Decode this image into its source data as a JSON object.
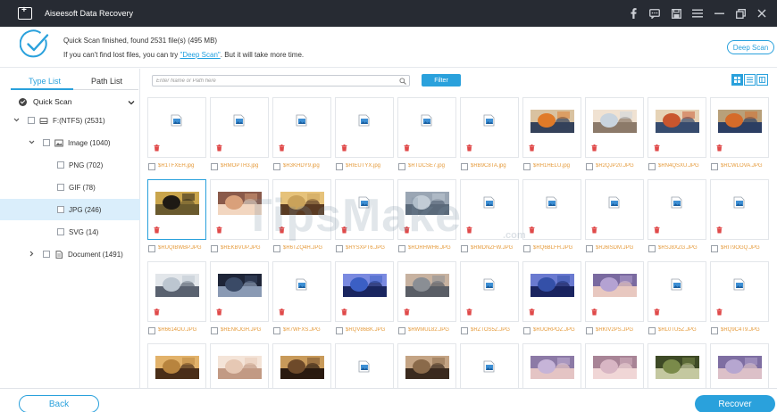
{
  "app": {
    "title": "Aiseesoft Data Recovery"
  },
  "titlebar_icons": [
    "facebook-icon",
    "chat-icon",
    "save-icon",
    "menu-icon",
    "minimize-icon",
    "restore-icon",
    "close-icon"
  ],
  "header": {
    "status": "Quick Scan finished, found 2531 file(s) (495 MB)",
    "hint_prefix": "If you can't find lost files, you can try ",
    "hint_link": "\"Deep Scan\"",
    "hint_suffix": ". But it will take more time.",
    "deep_scan_label": "Deep Scan"
  },
  "sidebar": {
    "tabs": [
      "Type List",
      "Path List"
    ],
    "active_tab": 0,
    "scan_mode": "Quick Scan",
    "tree": [
      {
        "label": "F:(NTFS) (2531)",
        "level": 0,
        "expanded": true,
        "icon": "drive-icon"
      },
      {
        "label": "Image (1040)",
        "level": 1,
        "expanded": true,
        "icon": "image-folder-icon"
      },
      {
        "label": "PNG (702)",
        "level": 2
      },
      {
        "label": "GIF (78)",
        "level": 2
      },
      {
        "label": "JPG (246)",
        "level": 2,
        "selected": true
      },
      {
        "label": "SVG (14)",
        "level": 2
      },
      {
        "label": "Document (1491)",
        "level": 1,
        "expanded": false,
        "icon": "document-icon"
      }
    ]
  },
  "toolbar": {
    "search_placeholder": "Enter Name or Path here",
    "filter_label": "Filter",
    "view_modes": [
      "grid-view-icon",
      "list-view-icon",
      "detail-view-icon"
    ]
  },
  "files": [
    {
      "name": "$R1TFXEH.jpg",
      "photo": false
    },
    {
      "name": "$RMOPTH3.jpg",
      "photo": false
    },
    {
      "name": "$R3KHDY9.jpg",
      "photo": false
    },
    {
      "name": "$RIEUTYX.jpg",
      "photo": false
    },
    {
      "name": "$RTDCSE7.jpg",
      "photo": false
    },
    {
      "name": "$RB9C8TA.jpg",
      "photo": false
    },
    {
      "name": "$RH1HELU.jpg",
      "photo": true,
      "colors": [
        "#e07a28",
        "#35425a",
        "#d9c2a0"
      ]
    },
    {
      "name": "$R2QJP20.JPG",
      "photo": true,
      "colors": [
        "#c9d4de",
        "#8c7a6a",
        "#f0e2d2"
      ]
    },
    {
      "name": "$RN4QSXU.JPG",
      "photo": true,
      "colors": [
        "#c9562e",
        "#374c6e",
        "#e6d3b6"
      ]
    },
    {
      "name": "$RCWLOVA.JPG",
      "photo": true,
      "colors": [
        "#d56b2a",
        "#2c3e63",
        "#b8a07a"
      ]
    },
    {
      "name": "$RUQIBWBP.JPG",
      "photo": true,
      "selected": true,
      "colors": [
        "#1e1a14",
        "#6a5a2e",
        "#c9a54c"
      ]
    },
    {
      "name": "$REKBVUP.JPG",
      "photo": true,
      "colors": [
        "#d9a07a",
        "#f2d6c0",
        "#8a5a4a"
      ]
    },
    {
      "name": "$R6TZQ4H.JPG",
      "photo": true,
      "colors": [
        "#caa25a",
        "#5a3b22",
        "#e6c27a"
      ]
    },
    {
      "name": "$RYSXPT6.JPG",
      "photo": false
    },
    {
      "name": "$RORHWH6.JPG",
      "photo": true,
      "colors": [
        "#c2ccd6",
        "#5b6a7a",
        "#9aa6b4"
      ]
    },
    {
      "name": "$RMDNZFW.JPG",
      "photo": false
    },
    {
      "name": "$RQ6BLFH.JPG",
      "photo": false
    },
    {
      "name": "$RJ6ISDM.JPG",
      "photo": false
    },
    {
      "name": "$RSJ8XZG.JPG",
      "photo": false
    },
    {
      "name": "$RIT9OGQ.JPG",
      "photo": false
    },
    {
      "name": "$R6614OU.JPG",
      "photo": true,
      "colors": [
        "#bcc6d0",
        "#5a6270",
        "#e2e6ea"
      ]
    },
    {
      "name": "$RENKJGH.JPG",
      "photo": true,
      "colors": [
        "#3a4a66",
        "#8a9ab4",
        "#1e2538"
      ]
    },
    {
      "name": "$R7WFXS.JPG",
      "photo": false
    },
    {
      "name": "$RQV86BK.JPG",
      "photo": true,
      "colors": [
        "#3b5fc4",
        "#1a2660",
        "#7a8ae0"
      ]
    },
    {
      "name": "$RWMUL82.JPG",
      "photo": true,
      "colors": [
        "#8a8e94",
        "#5a5e66",
        "#c7b2a0"
      ]
    },
    {
      "name": "$RZTOS5Z.JPG",
      "photo": false
    },
    {
      "name": "$RUORPOZ.JPG",
      "photo": true,
      "colors": [
        "#3450a8",
        "#1a2460",
        "#6a7ad0"
      ]
    },
    {
      "name": "$RKIV2PS.JPG",
      "photo": true,
      "colors": [
        "#b4a2d2",
        "#e8c8c0",
        "#7a6aa0"
      ]
    },
    {
      "name": "$RL0TU5Z.JPG",
      "photo": false
    },
    {
      "name": "$RQ9C4T9.JPG",
      "photo": false
    },
    {
      "name": "",
      "photo": true,
      "colors": [
        "#b8843e",
        "#4a2e18",
        "#e2b26a"
      ]
    },
    {
      "name": "",
      "photo": true,
      "colors": [
        "#e6c8b4",
        "#c29a84",
        "#f4e4d8"
      ]
    },
    {
      "name": "",
      "photo": true,
      "colors": [
        "#6e4a2a",
        "#2a1a10",
        "#c89a5a"
      ]
    },
    {
      "name": "",
      "photo": false
    },
    {
      "name": "",
      "photo": true,
      "colors": [
        "#8a6a4a",
        "#3a2a1e",
        "#c4a484"
      ]
    },
    {
      "name": "",
      "photo": false
    },
    {
      "name": "",
      "photo": true,
      "colors": [
        "#c6b4d8",
        "#e4c4c4",
        "#8c7aa6"
      ]
    },
    {
      "name": "",
      "photo": true,
      "colors": [
        "#d8b6c4",
        "#f0d6d6",
        "#a88496"
      ]
    },
    {
      "name": "",
      "photo": true,
      "colors": [
        "#7a8a4a",
        "#c4c8a0",
        "#3e4a26"
      ]
    },
    {
      "name": "",
      "photo": true,
      "colors": [
        "#b6a6d0",
        "#dcc0c8",
        "#7e6ea2"
      ]
    }
  ],
  "watermark": {
    "text": "TipsMake",
    "suffix": ".com"
  },
  "footer": {
    "back_label": "Back",
    "recover_label": "Recover"
  }
}
